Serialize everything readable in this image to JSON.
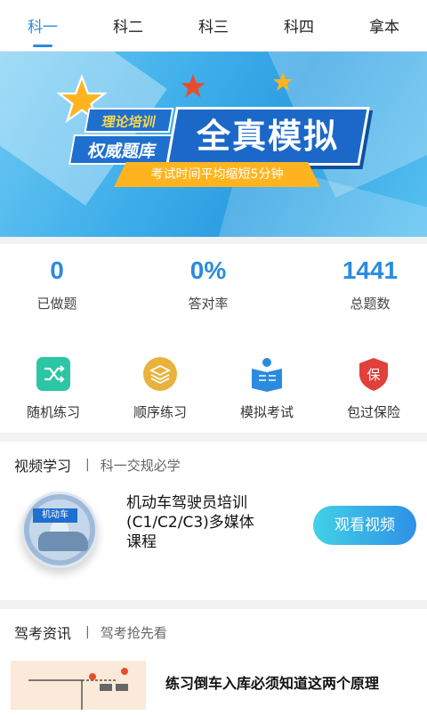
{
  "tabs": [
    "科一",
    "科二",
    "科三",
    "科四",
    "拿本"
  ],
  "active_tab": 0,
  "banner": {
    "label_top": "理论培训",
    "label_bottom": "权威题库",
    "main": "全真模拟",
    "sub": "考试时间平均缩短5分钟"
  },
  "stats": [
    {
      "value": "0",
      "label": "已做题"
    },
    {
      "value": "0%",
      "label": "答对率"
    },
    {
      "value": "1441",
      "label": "总题数"
    }
  ],
  "actions": [
    {
      "label": "随机练习",
      "icon": "shuffle-icon",
      "color": "#2bc6a3"
    },
    {
      "label": "顺序练习",
      "icon": "layers-icon",
      "color": "#e8b23c"
    },
    {
      "label": "模拟考试",
      "icon": "exam-book-icon",
      "color": "#2a8be0"
    },
    {
      "label": "包过保险",
      "icon": "shield-icon",
      "color": "#e0413a",
      "glyph": "保"
    }
  ],
  "video": {
    "title": "视频学习",
    "subtitle": "科一交规必学",
    "course": "机动车驾驶员培训(C1/C2/C3)多媒体课程",
    "disc_caption": "机动车",
    "button": "观看视频"
  },
  "news": {
    "title": "驾考资讯",
    "subtitle": "驾考抢先看",
    "item_title": "练习倒车入库必须知道这两个原理"
  },
  "colors": {
    "accent": "#2a8be0",
    "banner": "#3eaeea"
  }
}
